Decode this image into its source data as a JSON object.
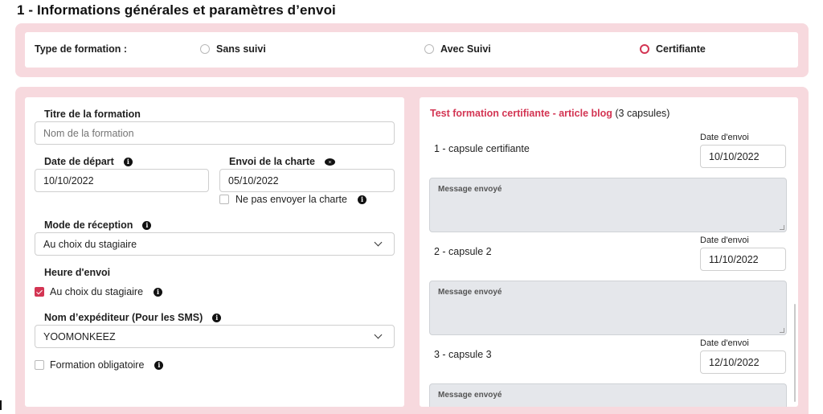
{
  "section_title": "1 - Informations générales et paramètres d’envoi",
  "type_formation": {
    "label": "Type de formation :",
    "options": [
      {
        "label": "Sans suivi",
        "selected": false
      },
      {
        "label": "Avec Suivi",
        "selected": false
      },
      {
        "label": "Certifiante",
        "selected": true
      }
    ]
  },
  "form": {
    "titre_label": "Titre de la formation",
    "titre_placeholder": "Nom de la formation",
    "date_depart_label": "Date de départ",
    "date_depart_value": "10/10/2022",
    "envoi_charte_label": "Envoi de la charte",
    "envoi_charte_value": "05/10/2022",
    "ne_pas_envoyer_label": "Ne pas envoyer la charte",
    "ne_pas_envoyer_checked": false,
    "mode_reception_label": "Mode de réception",
    "mode_reception_value": "Au choix du stagiaire",
    "heure_envoi_label": "Heure d'envoi",
    "heure_choix_label": "Au choix du stagiaire",
    "heure_choix_checked": true,
    "expediteur_label": "Nom d’expéditeur (Pour les SMS)",
    "expediteur_value": "YOOMONKEEZ",
    "obligatoire_label": "Formation obligatoire",
    "obligatoire_checked": false
  },
  "right": {
    "title_red": "Test formation certifiante - article blog",
    "title_count": " (3 capsules)",
    "date_label": "Date d'envoi",
    "message_label": "Message envoyé",
    "capsules": [
      {
        "name": "1 - capsule certifiante",
        "date": "10/10/2022"
      },
      {
        "name": "2 - capsule 2",
        "date": "11/10/2022"
      },
      {
        "name": "3 - capsule 3",
        "date": "12/10/2022"
      }
    ]
  },
  "colors": {
    "accent": "#d33553",
    "pink_band": "#f7d9de",
    "message_bg": "#e5e7eb"
  },
  "icons": [
    "info-icon",
    "eye-icon",
    "chevron-down-icon",
    "checkbox-checked-icon",
    "radio-checked-icon"
  ]
}
